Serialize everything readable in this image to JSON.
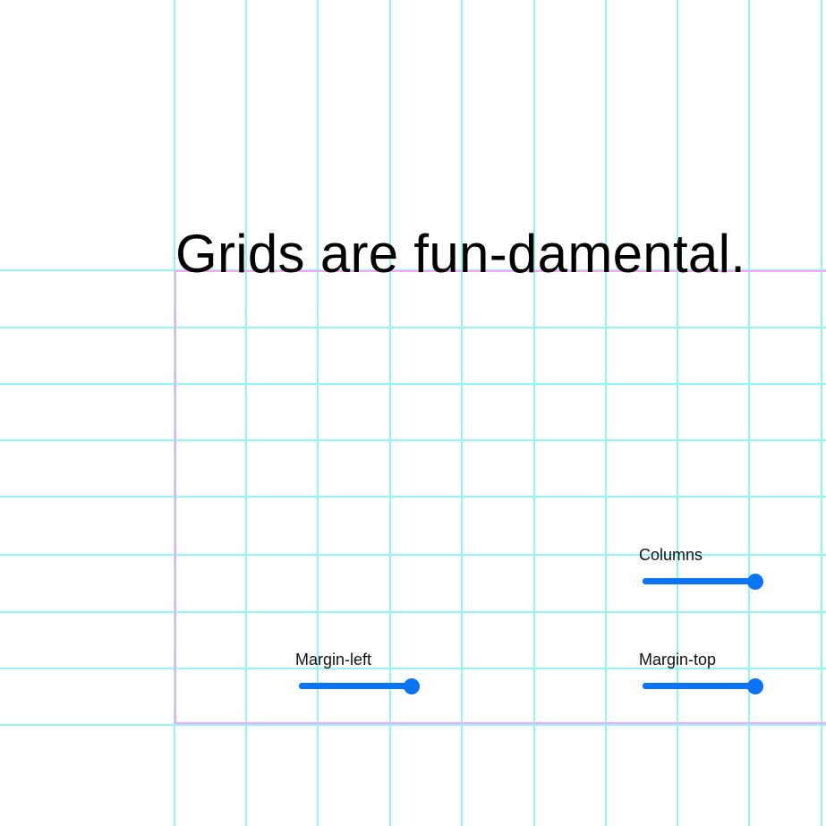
{
  "headline": "Grids are fun-damental.",
  "colors": {
    "grid_line": "#8ff8f4",
    "frame": "#ffa3f7",
    "slider": "#0a74f5",
    "text": "#000000"
  },
  "controls": {
    "columns": {
      "label": "Columns",
      "value": 1.0
    },
    "margin_left": {
      "label": "Margin-left",
      "value": 1.0
    },
    "margin_top": {
      "label": "Margin-top",
      "value": 1.0
    }
  }
}
